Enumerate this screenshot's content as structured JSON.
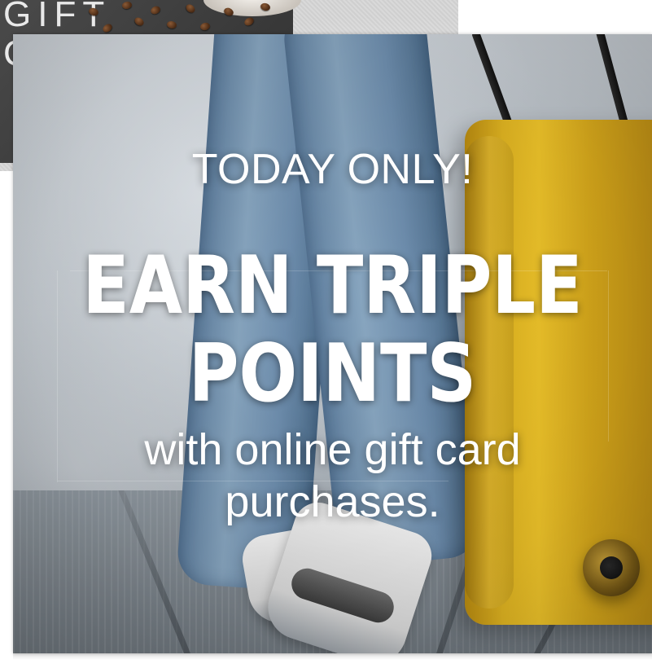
{
  "back_card": {
    "label": "GIFT",
    "label_fragment": "C"
  },
  "promo": {
    "kicker": "TODAY ONLY!",
    "headline_line1": "EARN TRIPLE",
    "headline_line2": "POINTS",
    "subline_line1": "with online gift card",
    "subline_line2": "purchases."
  },
  "colors": {
    "text": "#ffffff",
    "suitcase": "#e1b521",
    "jeans": "#7e9fbf",
    "background": "#ffffff"
  },
  "icons": {
    "coffee-beans": "coffee-beans-icon"
  }
}
